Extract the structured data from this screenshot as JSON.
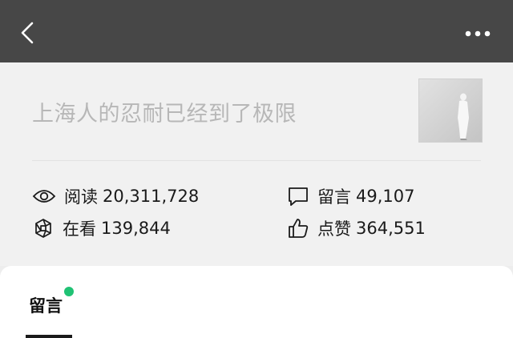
{
  "header": {
    "back_icon": "chevron-left-icon",
    "more_icon": "more-dots-icon"
  },
  "article": {
    "title": "上海人的忍耐已经到了极限",
    "thumbnail_icon": "figure-thumbnail"
  },
  "stats": {
    "read_label": "阅读",
    "read_value": "20,311,728",
    "comment_label": "留言",
    "comment_value": "49,107",
    "watching_label": "在看",
    "watching_value": "139,844",
    "like_label": "点赞",
    "like_value": "364,551"
  },
  "comments": {
    "tab_label": "留言",
    "badge_color": "#20c274"
  },
  "colors": {
    "topbar": "#474747",
    "background": "#ededed",
    "title": "#b7b7b7"
  }
}
